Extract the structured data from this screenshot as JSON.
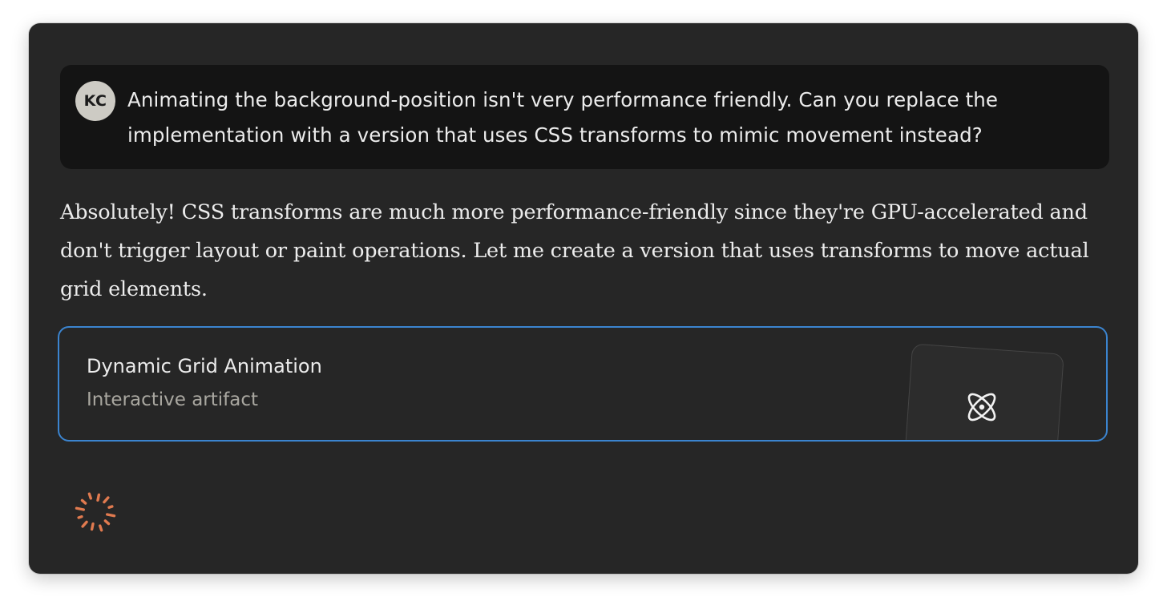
{
  "user_message": {
    "avatar_initials": "KC",
    "text": "Animating the background-position isn't very performance friendly. Can you replace the implementation with a version that uses CSS transforms to mimic movement instead?"
  },
  "assistant_message": {
    "text": "Absolutely! CSS transforms are much more performance-friendly since they're GPU-accelerated and don't trigger layout or paint operations. Let me create a version that uses transforms to move actual grid elements."
  },
  "artifact": {
    "title": "Dynamic Grid Animation",
    "subtitle": "Interactive artifact",
    "icon": "atom-icon"
  },
  "loading": {
    "icon": "spinner-icon"
  },
  "colors": {
    "window_bg": "#262626",
    "user_bubble_bg": "#141414",
    "avatar_bg": "#cdcbc4",
    "text_primary": "#ececec",
    "text_secondary": "#a9a7a0",
    "artifact_border": "#3b84cf",
    "spinner": "#e07a4f"
  }
}
